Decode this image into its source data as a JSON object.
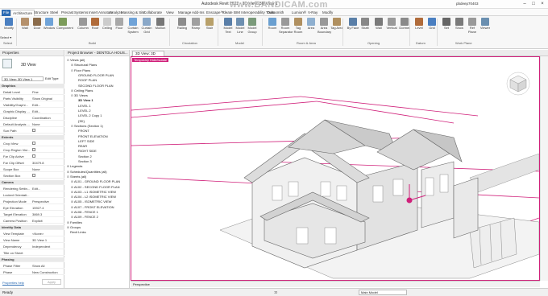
{
  "app": {
    "title": "Autodesk Revit 2022 - 3D View: 3D View 1",
    "watermark": "www.BANDICAM.com",
    "user": "pbdeep70403"
  },
  "tabs": [
    "File",
    "Architecture",
    "Structure",
    "Steel",
    "Precast",
    "Systems",
    "Insert",
    "Annotate",
    "Analyze",
    "Massing & Site",
    "Collaborate",
    "View",
    "Manage",
    "Add-Ins",
    "Enscape™",
    "Ideate",
    "BIM Interoperability Tools",
    "Datasmith",
    "Lumion®",
    "V-Ray",
    "Modify"
  ],
  "ribbon": {
    "buttons": [
      "Modify",
      "Wall",
      "Door",
      "Window",
      "Component",
      "Column",
      "Roof",
      "Ceiling",
      "Floor",
      "Curtain System",
      "Curtain Grid",
      "Mullion",
      "Railing",
      "Ramp",
      "Stair",
      "Model Text",
      "Model Line",
      "Model Group",
      "Room",
      "Room Separator",
      "Tag Room",
      "Area",
      "Area Boundary",
      "Tag Area",
      "By Face",
      "Shaft",
      "Wall",
      "Vertical",
      "Dormer",
      "Level",
      "Grid",
      "Set",
      "Show",
      "Ref Plane",
      "Viewer"
    ],
    "groups": [
      "Select",
      "Build",
      "Circulation",
      "Model",
      "Room & Area",
      "Opening",
      "Datum",
      "Work Plane"
    ],
    "select_label": "Select ▾"
  },
  "properties": {
    "title": "Properties",
    "type_name": "3D View",
    "view_selector": "3D View: 3D View 1",
    "edit_type": "Edit Type",
    "rows": [
      {
        "cat": true,
        "k": "Graphics",
        "v": ""
      },
      {
        "k": "Detail Level",
        "v": "Fine"
      },
      {
        "k": "Parts Visibility",
        "v": "Show Original"
      },
      {
        "k": "Visibility/Graphi...",
        "v": "Edit..."
      },
      {
        "k": "Graphic Display ...",
        "v": "Edit..."
      },
      {
        "k": "Discipline",
        "v": "Coordination"
      },
      {
        "k": "Default Analysis ...",
        "v": "None"
      },
      {
        "k": "Sun Path",
        "v": "",
        "check": true
      },
      {
        "cat": true,
        "k": "Extents",
        "v": ""
      },
      {
        "k": "Crop View",
        "v": "",
        "check": true
      },
      {
        "k": "Crop Region Visi...",
        "v": "",
        "check": true
      },
      {
        "k": "Far Clip Active",
        "v": "",
        "check": true
      },
      {
        "k": "Far Clip Offset",
        "v": "30479.8"
      },
      {
        "k": "Scope Box",
        "v": "None"
      },
      {
        "k": "Section Box",
        "v": "",
        "check": true
      },
      {
        "cat": true,
        "k": "Camera",
        "v": ""
      },
      {
        "k": "Rendering Settin...",
        "v": "Edit..."
      },
      {
        "k": "Locked Orientati...",
        "v": ""
      },
      {
        "k": "Projection Mode",
        "v": "Perspective"
      },
      {
        "k": "Eye Elevation",
        "v": "15927.4"
      },
      {
        "k": "Target Elevation",
        "v": "3869.3"
      },
      {
        "k": "Camera Position",
        "v": "Explicit"
      },
      {
        "cat": true,
        "k": "Identity Data",
        "v": ""
      },
      {
        "k": "View Template",
        "v": "<None>"
      },
      {
        "k": "View Name",
        "v": "3D View 1"
      },
      {
        "k": "Dependency",
        "v": "Independent"
      },
      {
        "k": "Title on Sheet",
        "v": ""
      },
      {
        "cat": true,
        "k": "Phasing",
        "v": ""
      },
      {
        "k": "Phase Filter",
        "v": "Show All"
      },
      {
        "k": "Phase",
        "v": "New Construction"
      }
    ],
    "help_link": "Properties help",
    "apply": "Apply"
  },
  "browser": {
    "title": "Project Browser - DENTOLA HOUS...",
    "items": [
      {
        "d": 0,
        "t": "⊟",
        "l": "Views (all)"
      },
      {
        "d": 1,
        "t": "⊞",
        "l": "Structural Plans"
      },
      {
        "d": 1,
        "t": "⊟",
        "l": "Floor Plans"
      },
      {
        "d": 2,
        "t": "",
        "l": "GROUND FLOOR PLAN"
      },
      {
        "d": 2,
        "t": "",
        "l": "ROOF PLAN"
      },
      {
        "d": 2,
        "t": "",
        "l": "SECOND FLOOR PLAN"
      },
      {
        "d": 1,
        "t": "⊞",
        "l": "Ceiling Plans"
      },
      {
        "d": 1,
        "t": "⊟",
        "l": "3D Views"
      },
      {
        "d": 2,
        "t": "",
        "l": "3D View 1",
        "sel": true
      },
      {
        "d": 2,
        "t": "",
        "l": "LEVEL 1"
      },
      {
        "d": 2,
        "t": "",
        "l": "LEVEL 2"
      },
      {
        "d": 2,
        "t": "",
        "l": "LEVEL 2 Copy 1"
      },
      {
        "d": 2,
        "t": "",
        "l": "{3D}"
      },
      {
        "d": 1,
        "t": "⊟",
        "l": "Sections (Section 1)"
      },
      {
        "d": 2,
        "t": "",
        "l": "FRONT"
      },
      {
        "d": 2,
        "t": "",
        "l": "FRONT ELEVATION"
      },
      {
        "d": 2,
        "t": "",
        "l": "LEFT SIDE"
      },
      {
        "d": 2,
        "t": "",
        "l": "REAR"
      },
      {
        "d": 2,
        "t": "",
        "l": "RIGHT SIDE"
      },
      {
        "d": 2,
        "t": "",
        "l": "Section 2"
      },
      {
        "d": 2,
        "t": "",
        "l": "Section 3"
      },
      {
        "d": 0,
        "t": "⊞",
        "l": "Legends"
      },
      {
        "d": 0,
        "t": "⊞",
        "l": "Schedules/Quantities (all)"
      },
      {
        "d": 0,
        "t": "⊟",
        "l": "Sheets (all)"
      },
      {
        "d": 1,
        "t": "⊞",
        "l": "A101 - GROUND FLOOR PLAN"
      },
      {
        "d": 1,
        "t": "⊞",
        "l": "A102 - SECOND FLOOR PLAN"
      },
      {
        "d": 1,
        "t": "⊞",
        "l": "A103 - L1 ISOMETRIC VIEW"
      },
      {
        "d": 1,
        "t": "⊞",
        "l": "A104 - L2 ISOMETRIC VIEW"
      },
      {
        "d": 1,
        "t": "⊞",
        "l": "A105 - ISOMETRIC VIEW"
      },
      {
        "d": 1,
        "t": "⊞",
        "l": "A107 - FRONT ELEVATION"
      },
      {
        "d": 1,
        "t": "⊞",
        "l": "A108 - FENCE 1"
      },
      {
        "d": 1,
        "t": "⊞",
        "l": "A109 - FENCE 2"
      },
      {
        "d": 0,
        "t": "⊞",
        "l": "Families"
      },
      {
        "d": 0,
        "t": "⊞",
        "l": "Groups"
      },
      {
        "d": 0,
        "t": "",
        "l": "Revit Links"
      }
    ]
  },
  "view": {
    "tab_label": "3D View: 3D View 1",
    "overlay_label": "Temporary Hide/Isolate",
    "projection": "Perspective",
    "main_model": "Main Model"
  },
  "status": {
    "left": "Ready",
    "zero": ":0"
  },
  "colors": {
    "accent": "#d0207a",
    "file_tab": "#2c6bb3"
  }
}
